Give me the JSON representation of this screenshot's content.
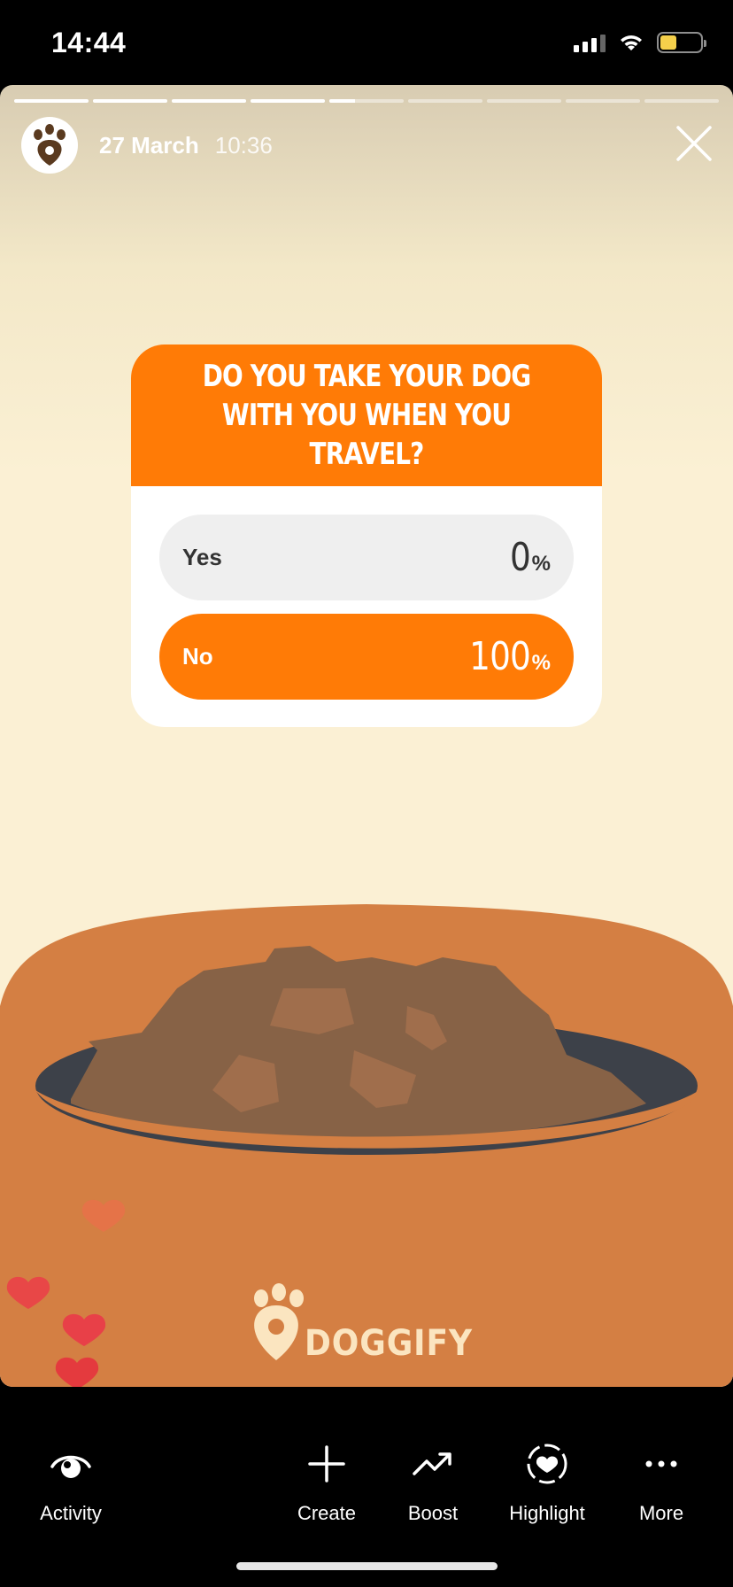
{
  "status_bar": {
    "time": "14:44",
    "icons": [
      "signal-icon",
      "wifi-icon",
      "battery-icon"
    ],
    "battery_color": "#f5d04b"
  },
  "story": {
    "date": "27 March",
    "time": "10:36",
    "progress": {
      "segments": 9,
      "completed": 4,
      "current_fraction": 0.35
    },
    "poll": {
      "question": "DO YOU TAKE YOUR DOG WITH YOU WHEN YOU TRAVEL?",
      "options": [
        {
          "label": "Yes",
          "percent": "0",
          "sign": "%"
        },
        {
          "label": "No",
          "percent": "100",
          "sign": "%"
        }
      ],
      "accent": "#ff7b06"
    },
    "brand": "DOGGIFY"
  },
  "actions": [
    {
      "label": "Activity",
      "icon": "activity-eye-icon"
    },
    {
      "label": "Create",
      "icon": "plus-icon"
    },
    {
      "label": "Boost",
      "icon": "trending-up-icon"
    },
    {
      "label": "Highlight",
      "icon": "highlight-heart-icon"
    },
    {
      "label": "More",
      "icon": "more-dots-icon"
    }
  ]
}
